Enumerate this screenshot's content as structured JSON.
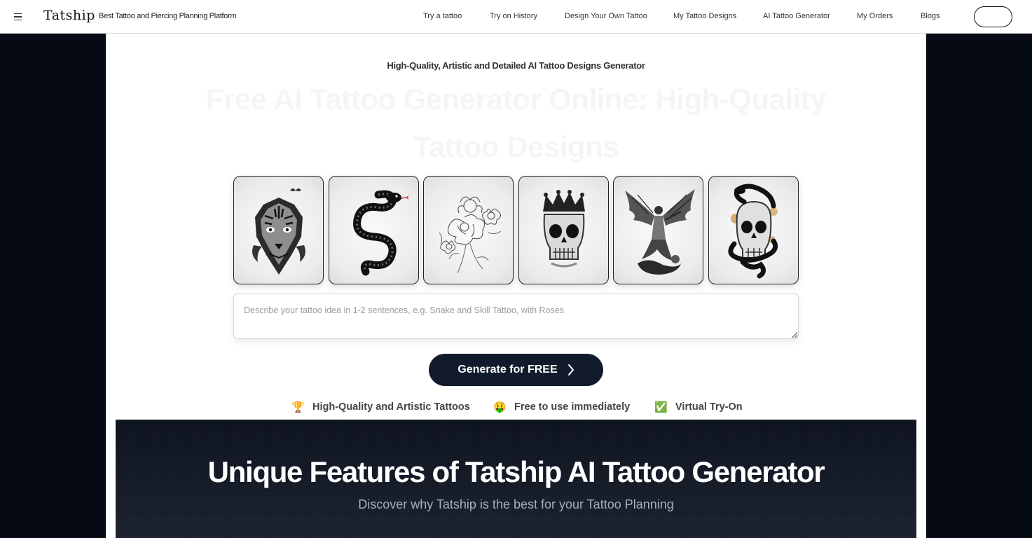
{
  "header": {
    "logo": "Tatship",
    "tagline": "Best Tattoo and Piercing Planning Platform",
    "nav": [
      {
        "label": "Try a tattoo"
      },
      {
        "label": "Try on History"
      },
      {
        "label": "Design Your Own Tattoo"
      },
      {
        "label": "My Tattoo Designs"
      },
      {
        "label": "AI Tattoo Generator"
      },
      {
        "label": "My Orders"
      },
      {
        "label": "Blogs"
      }
    ],
    "login_label": ""
  },
  "hero": {
    "eyebrow": "High-Quality, Artistic and Detailed AI Tattoo Designs Generator",
    "title": "Free AI Tattoo Generator Online: High-Quality Tattoo Designs"
  },
  "gallery": {
    "items": [
      {
        "icon": "tiger-tattoo-icon"
      },
      {
        "icon": "snake-tattoo-icon"
      },
      {
        "icon": "flowers-tattoo-icon"
      },
      {
        "icon": "crowned-skull-tattoo-icon"
      },
      {
        "icon": "angel-tattoo-icon"
      },
      {
        "icon": "snake-skull-tattoo-icon"
      }
    ]
  },
  "prompt": {
    "placeholder": "Describe your tattoo idea in 1-2 sentences, e.g. Snake and Skill Tattoo, with Roses",
    "value": ""
  },
  "generate": {
    "label": "Generate for FREE"
  },
  "perks": [
    {
      "emoji": "🏆",
      "label": "High-Quality and Artistic Tattoos"
    },
    {
      "emoji": "🤑",
      "label": "Free to use immediately"
    },
    {
      "emoji": "✅",
      "label": "Virtual Try-On"
    }
  ],
  "features": {
    "title": "Unique Features of Tatship AI Tattoo Generator",
    "subtitle": "Discover why Tatship is the best for your Tattoo Planning"
  },
  "colors": {
    "page_background": "#050a14",
    "button": "#111b2b",
    "hero_title": "#f4f5f7"
  }
}
